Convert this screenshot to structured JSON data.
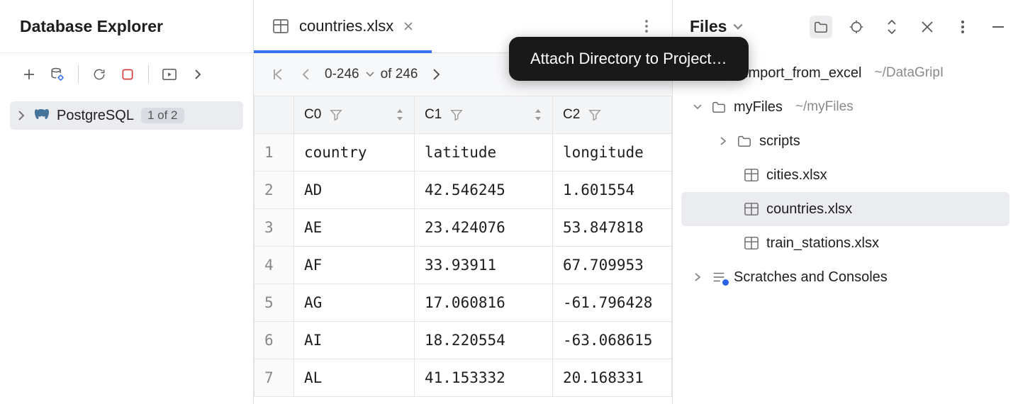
{
  "left": {
    "title": "Database Explorer",
    "db_label": "PostgreSQL",
    "db_count": "1 of 2"
  },
  "tab": {
    "label": "countries.xlsx"
  },
  "pager": {
    "range": "0-246",
    "of_label": "of 246"
  },
  "columns": [
    "C0",
    "C1",
    "C2"
  ],
  "rows": [
    {
      "n": "1",
      "c0": "country",
      "c1": "latitude",
      "c2": "longitude"
    },
    {
      "n": "2",
      "c0": "AD",
      "c1": "42.546245",
      "c2": "1.601554"
    },
    {
      "n": "3",
      "c0": "AE",
      "c1": "23.424076",
      "c2": "53.847818"
    },
    {
      "n": "4",
      "c0": "AF",
      "c1": "33.93911",
      "c2": "67.709953"
    },
    {
      "n": "5",
      "c0": "AG",
      "c1": "17.060816",
      "c2": "-61.796428"
    },
    {
      "n": "6",
      "c0": "AI",
      "c1": "18.220554",
      "c2": "-63.068615"
    },
    {
      "n": "7",
      "c0": "AL",
      "c1": "41.153332",
      "c2": "20.168331"
    }
  ],
  "right": {
    "title": "Files",
    "items": {
      "import": "import_from_excel",
      "import_path": "~/DataGripI",
      "myfiles": "myFiles",
      "myfiles_path": "~/myFiles",
      "scripts": "scripts",
      "cities": "cities.xlsx",
      "countries": "countries.xlsx",
      "train": "train_stations.xlsx",
      "scratches": "Scratches and Consoles"
    }
  },
  "tooltip": "Attach Directory to Project…"
}
